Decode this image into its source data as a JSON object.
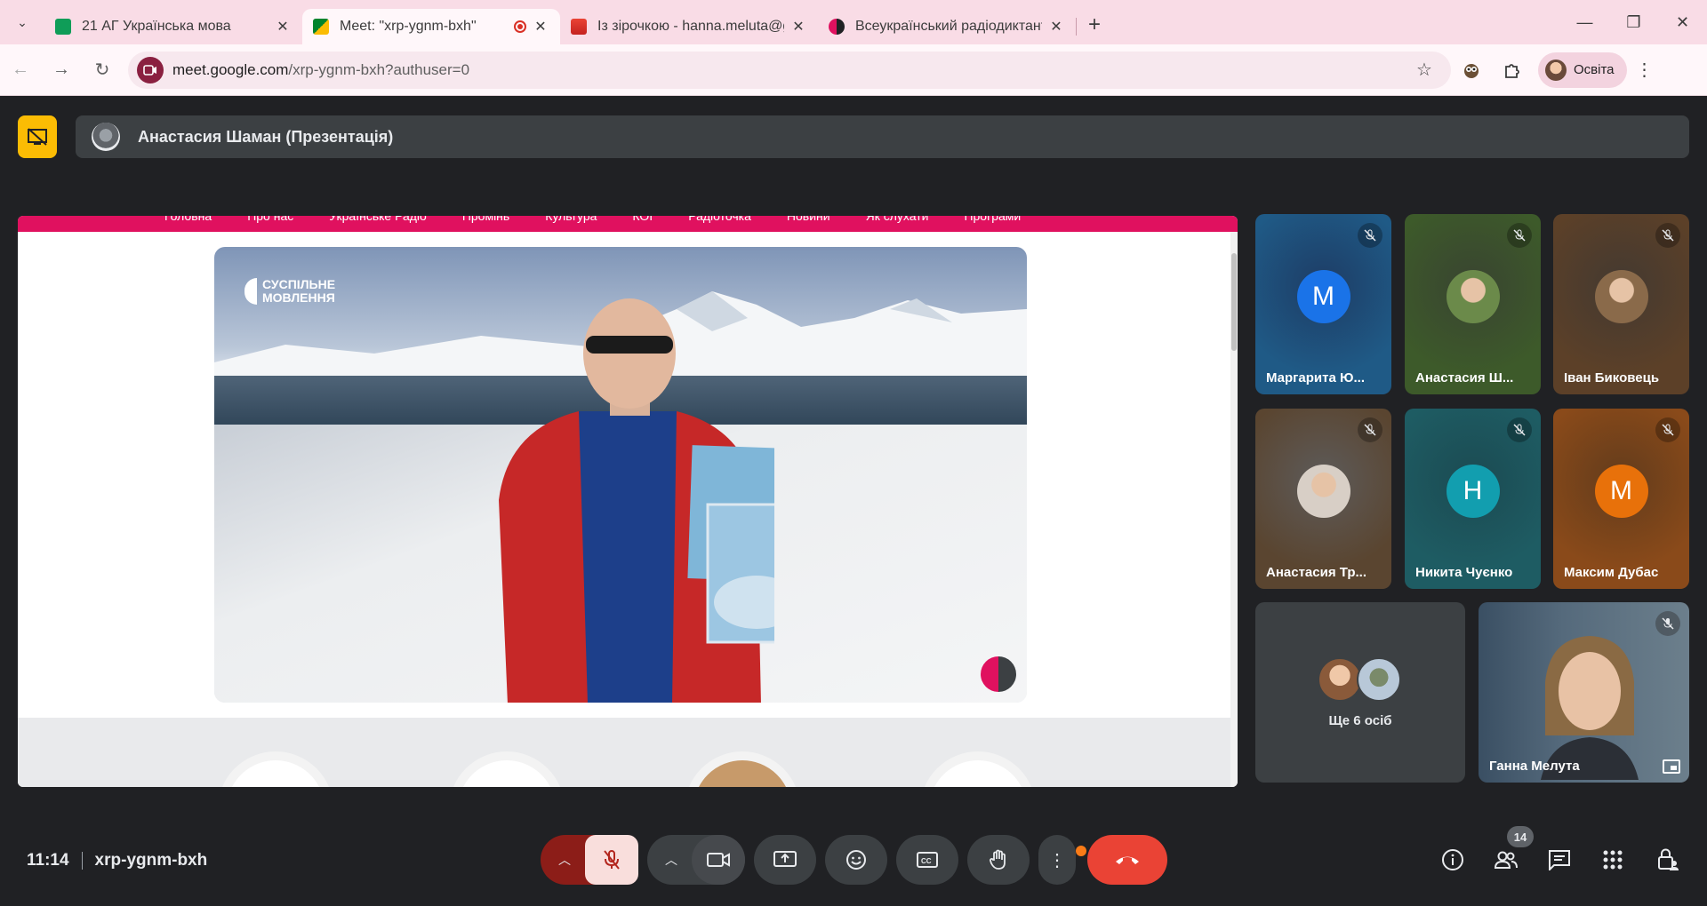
{
  "browser": {
    "tabs": [
      {
        "title": "21 АГ Українська мова",
        "favicon_color": "#0f9d58"
      },
      {
        "title": "Meet: \"xrp-ygnm-bxh\"",
        "favicon_color": "#00832d"
      },
      {
        "title": "Із зірочкою - hanna.meluta@g",
        "favicon_color": "#ea4335"
      },
      {
        "title": "Всеукраїнський радіодиктант",
        "favicon_color": "#e0115f"
      }
    ],
    "url_host": "meet.google.com",
    "url_path": "/xrp-ygnm-bxh?authuser=0",
    "profile_name": "Освіта"
  },
  "meet": {
    "presenter_title": "Анастасия Шаман (Презентація)",
    "site_nav": [
      "Головна",
      "Про нас",
      "Українське Радіо",
      "Промінь",
      "Культура",
      "КОІ",
      "Радіоточка",
      "Новини",
      "Як слухати",
      "Програми"
    ],
    "video_logo": "СУСПІЛЬНЕ\nМОВЛЕННЯ",
    "participants": [
      {
        "name": "Маргарита Ю...",
        "initial": "М",
        "avatar_color": "#1a73e8",
        "bg": "#1f5a86"
      },
      {
        "name": "Анастасия Ш...",
        "initial": "",
        "avatar_color": "#6b8a4a",
        "bg": "#3d5a2a"
      },
      {
        "name": "Іван Биковець",
        "initial": "",
        "avatar_color": "#8a6a4a",
        "bg": "#5c4028"
      },
      {
        "name": "Анастасия Тр...",
        "initial": "",
        "avatar_color": "#d8cfc6",
        "bg": "#5a4530"
      },
      {
        "name": "Никита Чуєнко",
        "initial": "Н",
        "avatar_color": "#129eaf",
        "bg": "#1e5c63"
      },
      {
        "name": "Максим Дубас",
        "initial": "М",
        "avatar_color": "#e8710a",
        "bg": "#8a4a1a"
      }
    ],
    "more_label": "Ще 6 осіб",
    "self_name": "Ганна Мелута",
    "time": "11:14",
    "meeting_code": "xrp-ygnm-bxh",
    "participant_count": "14"
  }
}
